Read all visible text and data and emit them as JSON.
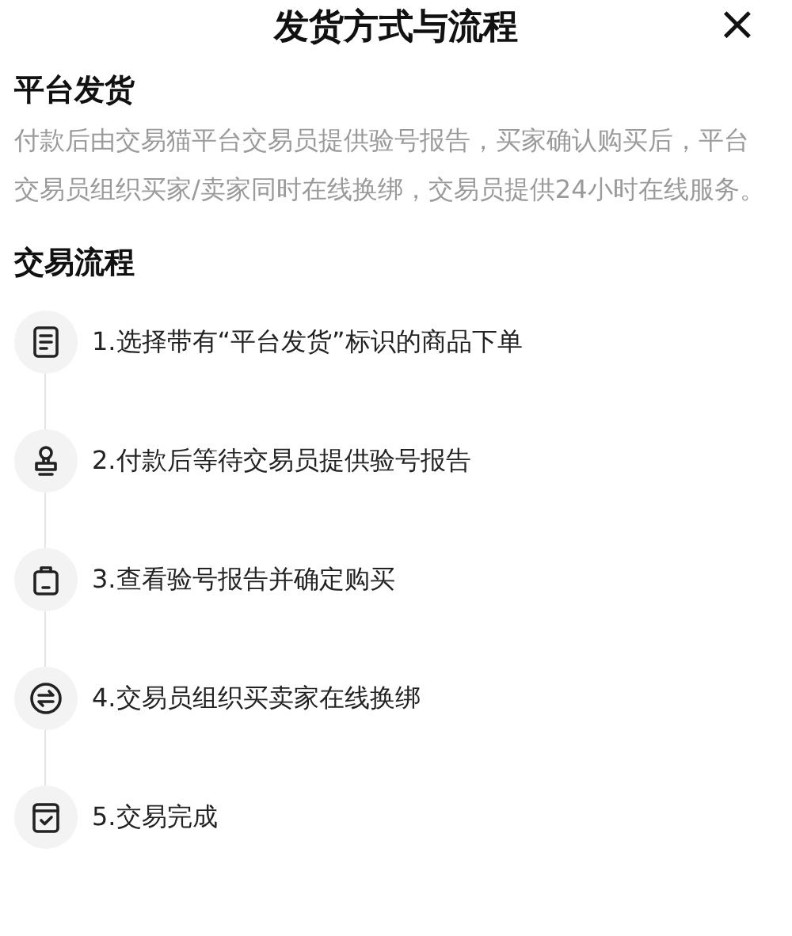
{
  "title": "发货方式与流程",
  "close": "×",
  "section": {
    "heading": "平台发货",
    "description": "付款后由交易猫平台交易员提供验号报告，买家确认购买后，平台交易员组织买家/卖家同时在线换绑，交易员提供24小时在线服务。"
  },
  "process": {
    "heading": "交易流程",
    "steps": [
      {
        "kind": "document",
        "label": "1.选择带有“平台发货”标识的商品下单"
      },
      {
        "kind": "stamp",
        "label": "2.付款后等待交易员提供验号报告"
      },
      {
        "kind": "bag",
        "label": "3.查看验号报告并确定购买"
      },
      {
        "kind": "exchange",
        "label": "4.交易员组织买卖家在线换绑"
      },
      {
        "kind": "check",
        "label": "5.交易完成"
      }
    ]
  }
}
